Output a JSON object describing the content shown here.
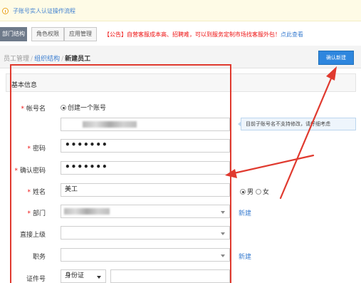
{
  "notice": {
    "link_text": "子账号实人认证操作流程",
    "icon": "info-icon"
  },
  "tabs": [
    "部门结构",
    "角色权限",
    "应用管理"
  ],
  "announcement": {
    "text": "【公告】自营客服成本高、招聘难，可以到服务定制市场找客服外包！",
    "view_link": "点此查看"
  },
  "breadcrumb": {
    "item1": "员工管理",
    "sep": "/",
    "item2": "组织结构",
    "current": "新建员工"
  },
  "confirm_button": "确认新建",
  "section_title": "基本信息",
  "form": {
    "account": {
      "label": "帐号名",
      "radio_label": "创建一个账号",
      "tip": "目前子账号名不支持修改，请仔细考虑"
    },
    "password": {
      "label": "密码",
      "value": "•••••••"
    },
    "confirm_password": {
      "label": "确认密码",
      "value": "•••••••"
    },
    "name": {
      "label": "姓名",
      "value": "美工",
      "male": "男",
      "female": "女"
    },
    "department": {
      "label": "部门",
      "new_link": "新建"
    },
    "superior": {
      "label": "直接上级"
    },
    "position": {
      "label": "职务",
      "new_link": "新建"
    },
    "id_number": {
      "label": "证件号",
      "type_value": "身份证"
    }
  },
  "required_mark": "*",
  "colors": {
    "accent": "#2e86de",
    "annotation": "#e03a2f",
    "link": "#3d7fd0",
    "warning": "#ee1111"
  }
}
